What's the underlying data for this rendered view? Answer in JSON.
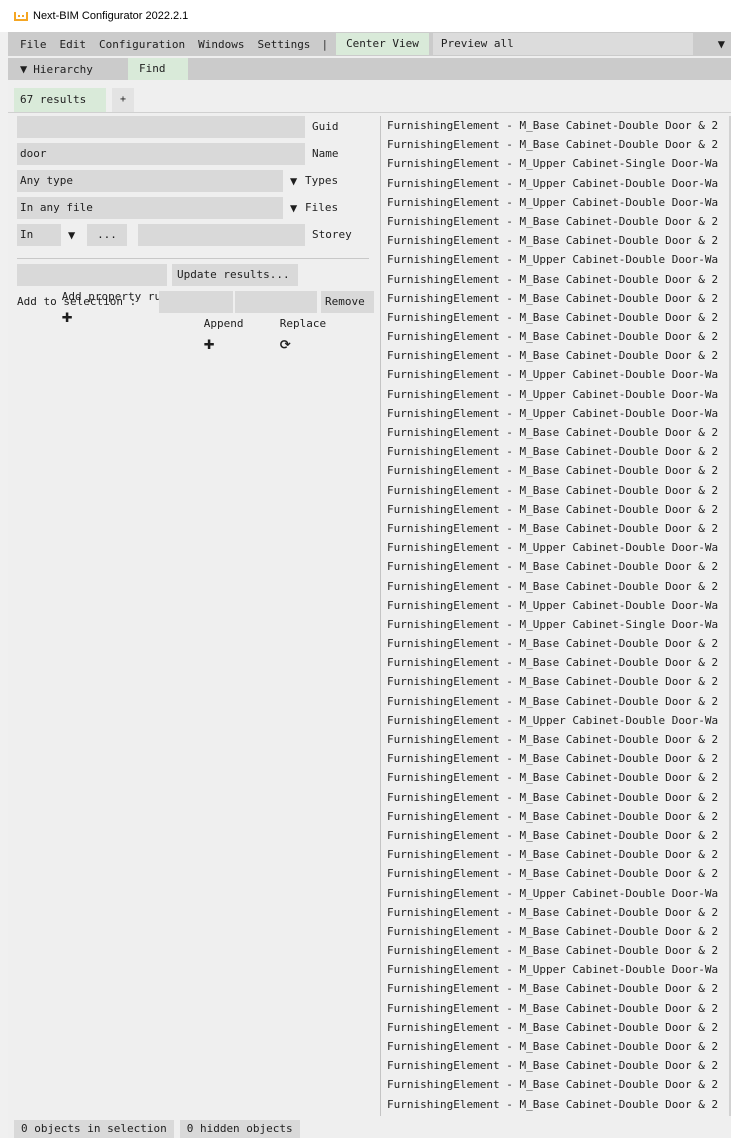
{
  "window": {
    "title": "Next-BIM Configurator 2022.2.1"
  },
  "menubar": {
    "items": [
      "File",
      "Edit",
      "Configuration",
      "Windows",
      "Settings"
    ],
    "separator": "|",
    "center_view": "Center View",
    "preview": "Preview all"
  },
  "toolbar": {
    "hierarchy": "Hierarchy",
    "find": "Find"
  },
  "tabs": {
    "results": "67 results",
    "add": "+"
  },
  "filters": {
    "guid": {
      "value": "",
      "label": "Guid"
    },
    "name": {
      "value": "door",
      "label": "Name"
    },
    "types": {
      "value": "Any type",
      "label": "Types"
    },
    "files": {
      "value": "In any file",
      "label": "Files"
    },
    "storey": {
      "mode": "In",
      "more": "...",
      "value": "",
      "label": "Storey"
    }
  },
  "actions": {
    "add_property_rule": "Add property rule",
    "update_results": "Update results...",
    "add_to_selection": "Add to selection :",
    "append": "Append",
    "replace": "Replace",
    "remove": "Remove"
  },
  "results": [
    "FurnishingElement - M_Base Cabinet-Double Door & 2",
    "FurnishingElement - M_Base Cabinet-Double Door & 2",
    "FurnishingElement - M_Upper Cabinet-Single Door-Wa",
    "FurnishingElement - M_Upper Cabinet-Double Door-Wa",
    "FurnishingElement - M_Upper Cabinet-Double Door-Wa",
    "FurnishingElement - M_Base Cabinet-Double Door & 2",
    "FurnishingElement - M_Base Cabinet-Double Door & 2",
    "FurnishingElement - M_Upper Cabinet-Double Door-Wa",
    "FurnishingElement - M_Base Cabinet-Double Door & 2",
    "FurnishingElement - M_Base Cabinet-Double Door & 2",
    "FurnishingElement - M_Base Cabinet-Double Door & 2",
    "FurnishingElement - M_Base Cabinet-Double Door & 2",
    "FurnishingElement - M_Base Cabinet-Double Door & 2",
    "FurnishingElement - M_Upper Cabinet-Double Door-Wa",
    "FurnishingElement - M_Upper Cabinet-Double Door-Wa",
    "FurnishingElement - M_Upper Cabinet-Double Door-Wa",
    "FurnishingElement - M_Base Cabinet-Double Door & 2",
    "FurnishingElement - M_Base Cabinet-Double Door & 2",
    "FurnishingElement - M_Base Cabinet-Double Door & 2",
    "FurnishingElement - M_Base Cabinet-Double Door & 2",
    "FurnishingElement - M_Base Cabinet-Double Door & 2",
    "FurnishingElement - M_Base Cabinet-Double Door & 2",
    "FurnishingElement - M_Upper Cabinet-Double Door-Wa",
    "FurnishingElement - M_Base Cabinet-Double Door & 2",
    "FurnishingElement - M_Base Cabinet-Double Door & 2",
    "FurnishingElement - M_Upper Cabinet-Double Door-Wa",
    "FurnishingElement - M_Upper Cabinet-Single Door-Wa",
    "FurnishingElement - M_Base Cabinet-Double Door & 2",
    "FurnishingElement - M_Base Cabinet-Double Door & 2",
    "FurnishingElement - M_Base Cabinet-Double Door & 2",
    "FurnishingElement - M_Base Cabinet-Double Door & 2",
    "FurnishingElement - M_Upper Cabinet-Double Door-Wa",
    "FurnishingElement - M_Base Cabinet-Double Door & 2",
    "FurnishingElement - M_Base Cabinet-Double Door & 2",
    "FurnishingElement - M_Base Cabinet-Double Door & 2",
    "FurnishingElement - M_Base Cabinet-Double Door & 2",
    "FurnishingElement - M_Base Cabinet-Double Door & 2",
    "FurnishingElement - M_Base Cabinet-Double Door & 2",
    "FurnishingElement - M_Base Cabinet-Double Door & 2",
    "FurnishingElement - M_Base Cabinet-Double Door & 2",
    "FurnishingElement - M_Upper Cabinet-Double Door-Wa",
    "FurnishingElement - M_Base Cabinet-Double Door & 2",
    "FurnishingElement - M_Base Cabinet-Double Door & 2",
    "FurnishingElement - M_Base Cabinet-Double Door & 2",
    "FurnishingElement - M_Upper Cabinet-Double Door-Wa",
    "FurnishingElement - M_Base Cabinet-Double Door & 2",
    "FurnishingElement - M_Base Cabinet-Double Door & 2",
    "FurnishingElement - M_Base Cabinet-Double Door & 2",
    "FurnishingElement - M_Base Cabinet-Double Door & 2",
    "FurnishingElement - M_Base Cabinet-Double Door & 2",
    "FurnishingElement - M_Base Cabinet-Double Door & 2",
    "FurnishingElement - M_Base Cabinet-Double Door & 2"
  ],
  "status": {
    "selection": "0 objects in selection",
    "hidden": "0 hidden objects"
  },
  "colors": {
    "accent_green": "#d9ead9",
    "logo": "#f5a623",
    "menubar": "#cbcbcb"
  },
  "icons": [
    "logo-icon",
    "dropdown-arrow-icon",
    "collapse-triangle-icon",
    "plus-icon",
    "refresh-icon"
  ]
}
